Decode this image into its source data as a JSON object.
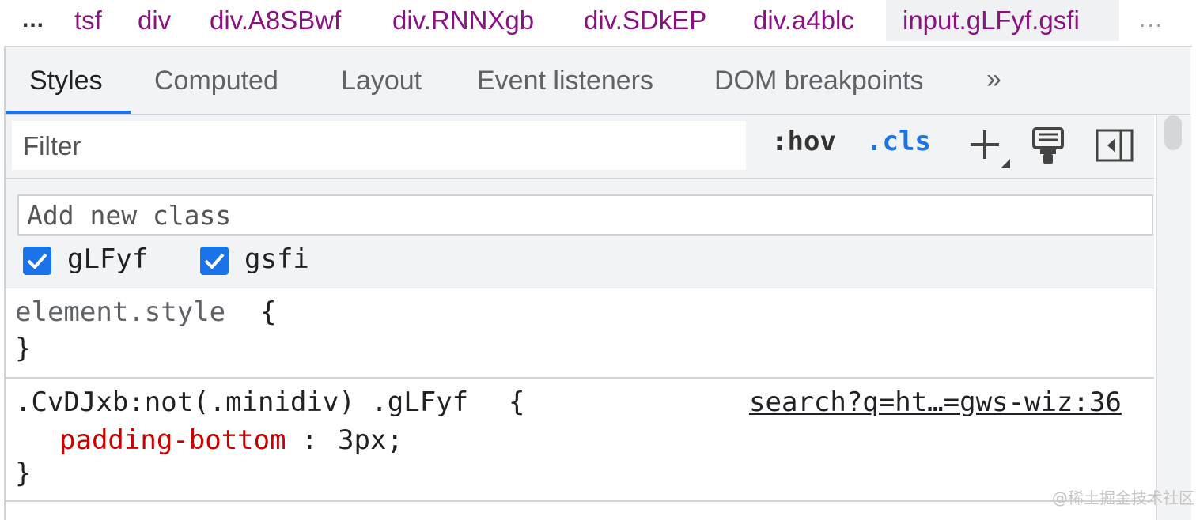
{
  "breadcrumb": {
    "more_left": "...",
    "items": [
      "tsf",
      "div",
      "div.A8SBwf",
      "div.RNNXgb",
      "div.SDkEP",
      "div.a4blc",
      "input.gLFyf.gsfi"
    ],
    "more_right": "..."
  },
  "tabs": {
    "items": [
      "Styles",
      "Computed",
      "Layout",
      "Event listeners",
      "DOM breakpoints"
    ],
    "active": "Styles",
    "more": "»"
  },
  "toolbar": {
    "filter_placeholder": "Filter",
    "hov": ":hov",
    "cls": ".cls",
    "new_rule_icon": "plus-icon",
    "paint_icon": "paint-brush-icon",
    "sidebar_icon": "toggle-sidebar-icon"
  },
  "class_pane": {
    "add_placeholder": "Add new class",
    "classes": [
      {
        "name": "gLFyf",
        "checked": true
      },
      {
        "name": "gsfi",
        "checked": true
      }
    ]
  },
  "rules": {
    "element_style": {
      "selector": "element.style",
      "open": "{",
      "close": "}"
    },
    "rule2": {
      "selector": ".CvDJxb:not(.minidiv) .gLFyf",
      "open": "{",
      "prop_name": "padding-bottom",
      "colon": ":",
      "prop_value": "3px",
      "semicolon": ";",
      "close": "}",
      "source": "search?q=ht…=gws-wiz:36"
    }
  },
  "watermark": "@稀土掘金技术社区",
  "colors": {
    "accent": "#1a73e8",
    "tag_purple": "#881280",
    "property_red": "#c80000"
  }
}
